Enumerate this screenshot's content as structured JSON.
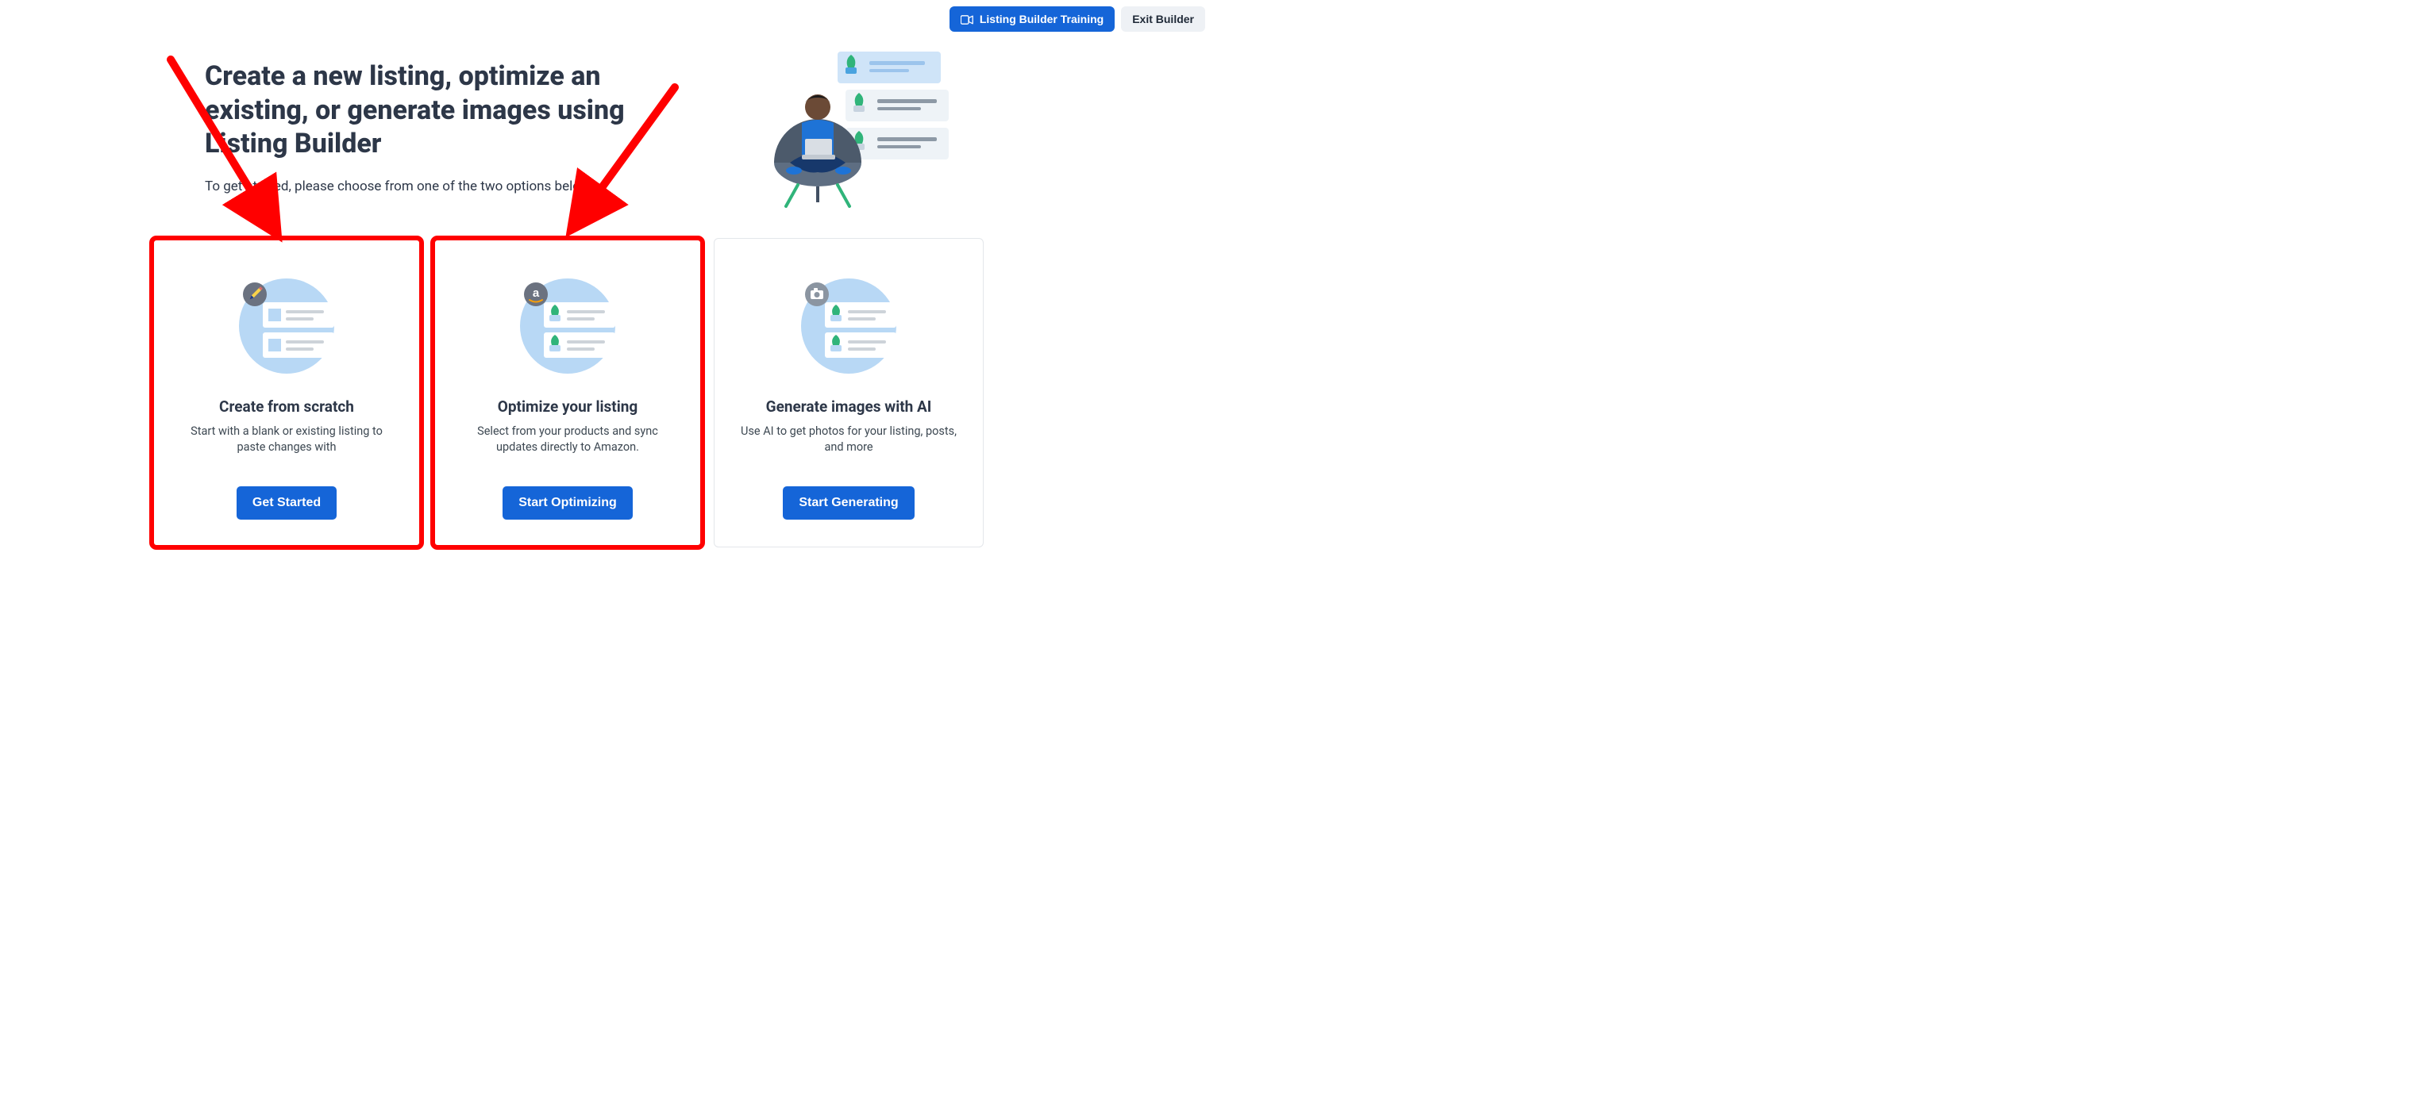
{
  "topbar": {
    "training_button": "Listing Builder Training",
    "exit_button": "Exit Builder"
  },
  "hero": {
    "title": "Create a new listing, optimize an existing, or generate images using Listing Builder",
    "subtitle": "To get started, please choose from one of the two options below."
  },
  "cards": [
    {
      "title": "Create from scratch",
      "description": "Start with a blank or existing listing to paste changes with",
      "button": "Get Started",
      "badge_icon": "pencil"
    },
    {
      "title": "Optimize your listing",
      "description": "Select from your products and sync updates directly to Amazon.",
      "button": "Start Optimizing",
      "badge_icon": "amazon"
    },
    {
      "title": "Generate images with AI",
      "description": "Use AI to get photos for your listing, posts, and more",
      "button": "Start Generating",
      "badge_icon": "camera"
    }
  ],
  "annotations": {
    "highlight_cards": [
      0,
      1
    ],
    "arrows": 2,
    "arrow_color": "#FF0000"
  }
}
